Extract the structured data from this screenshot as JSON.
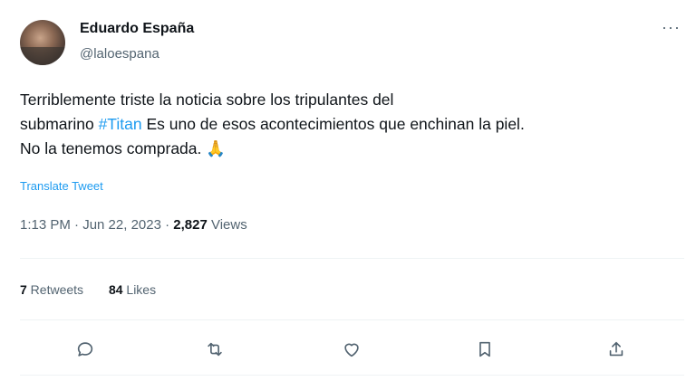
{
  "author": {
    "name": "Eduardo España",
    "handle": "@laloespana"
  },
  "more_label": "···",
  "tweet": {
    "line1": "Terriblemente triste la noticia sobre los tripulantes del",
    "line2_before": "submarino ",
    "hashtag": "#Titan",
    "line2_after": " Es uno de esos acontecimientos que enchinan la piel.",
    "line3": "No la tenemos comprada. ",
    "emoji": "🙏"
  },
  "translate_label": "Translate Tweet",
  "meta": {
    "timestamp": "1:13 PM · Jun 22, 2023 · ",
    "views_count": "2,827",
    "views_label": " Views"
  },
  "stats": {
    "retweets_count": "7",
    "retweets_label": " Retweets",
    "likes_count": "84",
    "likes_label": " Likes"
  },
  "actions": {
    "reply_icon": "reply-icon",
    "retweet_icon": "retweet-icon",
    "like_icon": "like-icon",
    "bookmark_icon": "bookmark-icon",
    "share_icon": "share-icon"
  },
  "colors": {
    "link": "#1d9bf0",
    "secondary_text": "#536471",
    "primary_text": "#0f1419",
    "divider": "#eff3f4"
  }
}
